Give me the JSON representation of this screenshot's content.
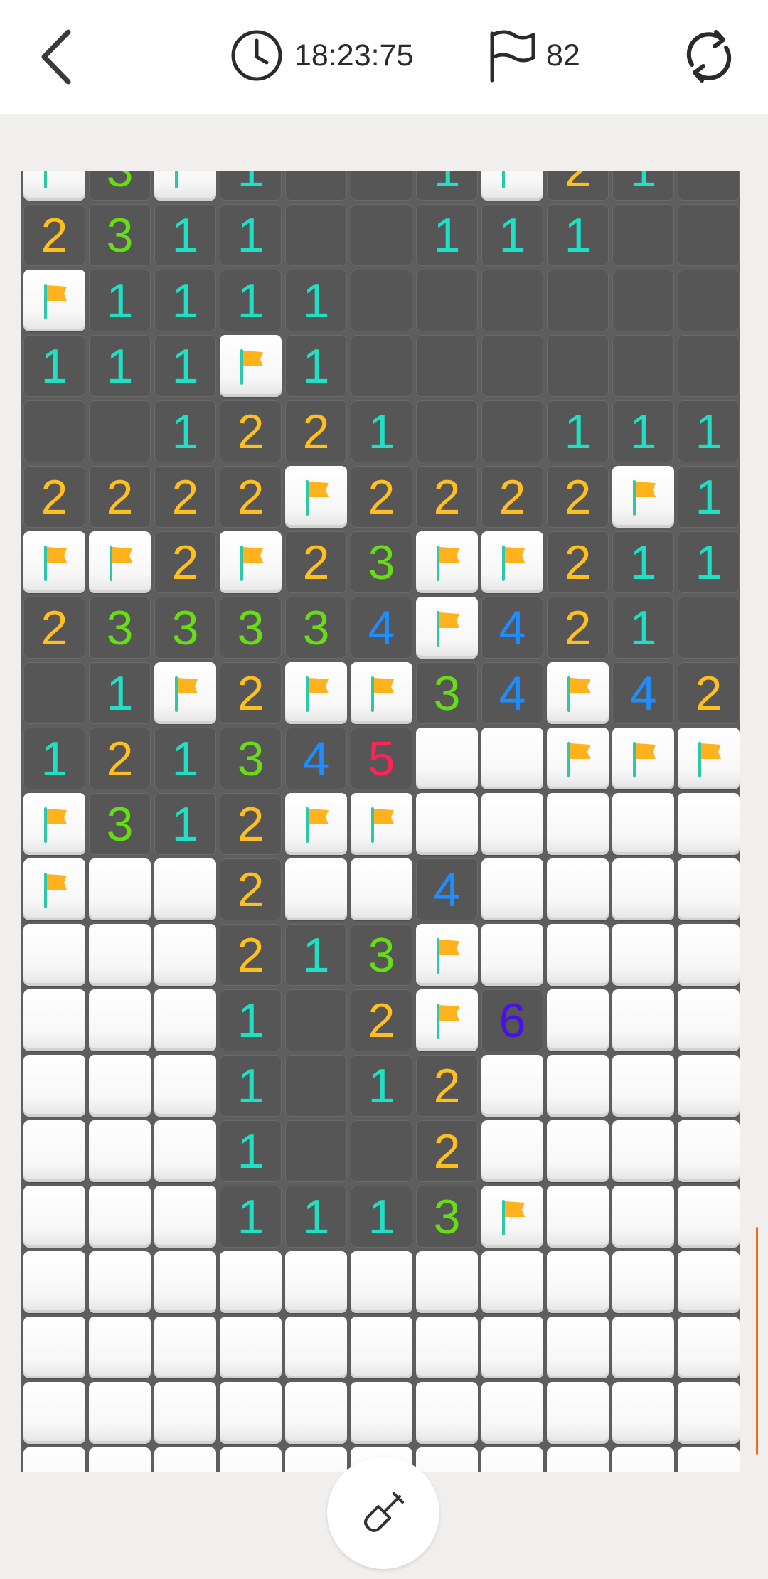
{
  "header": {
    "back_icon": "chevron-left-icon",
    "timer_icon": "clock-icon",
    "timer": "18:23:75",
    "flag_icon": "flag-outline-icon",
    "flag_count": "82",
    "restart_icon": "restart-icon"
  },
  "colors": {
    "1": "#1fe0c4",
    "2": "#ffbf1f",
    "3": "#66dd14",
    "4": "#1f8dff",
    "5": "#ff2457",
    "6": "#4712e6",
    "flag": "#ffb21b",
    "flag_pole": "#2ec7a9",
    "accent": "#f06a1a"
  },
  "board": {
    "columns": 11,
    "rows": [
      "F3F1..1F21.",
      "2311..111..",
      "F1111......",
      "111F1......",
      "..1221..111",
      "2222F2222F1",
      "FF2F23FF211",
      "233334F421.",
      ".1F2FF34F42",
      "121345##FFF",
      "F312FF#####",
      "F##2##4####",
      "###213F####",
      "###1.2F6###",
      "###1.12####",
      "###1..2####",
      "###1113F###",
      "###########",
      "###########",
      "###########",
      "###########"
    ]
  },
  "dig_button": {
    "icon": "shovel-icon",
    "mode": "dig"
  }
}
